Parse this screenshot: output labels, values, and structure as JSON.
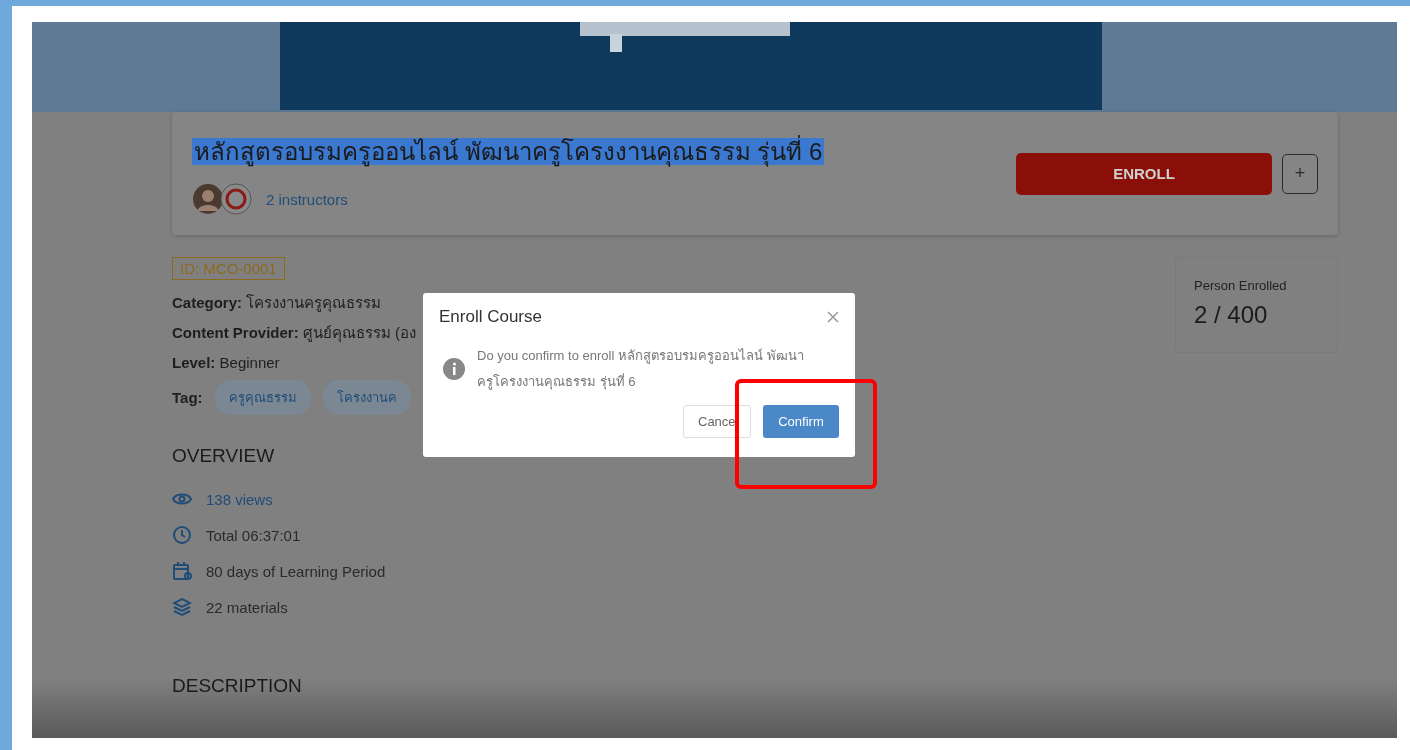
{
  "course": {
    "title": "หลักสูตรอบรมครูออนไลน์ พัฒนาครูโครงงานคุณธรรม รุ่นที่ 6",
    "title_selected": true,
    "instructors": "2 instructors",
    "enroll_button": "ENROLL",
    "add_button": "+"
  },
  "course_id": "ID: MCO-0001",
  "details": [
    {
      "label": "Category:",
      "value": "โครงงานครูคุณธรรม"
    },
    {
      "label": "Content Provider:",
      "value": "ศูนย์คุณธรรม (อง"
    },
    {
      "label": "Level:",
      "value": "Beginner"
    }
  ],
  "tags": {
    "label": "Tag:",
    "items": [
      "ครูคุณธรรม",
      "โครงงานค"
    ]
  },
  "enrollment": {
    "label": "Person Enrolled",
    "value": "2 / 400"
  },
  "overview": {
    "heading": "OVERVIEW",
    "items": [
      {
        "kind": "link",
        "text": "138 views"
      },
      {
        "kind": "text",
        "text": "Total 06:37:01"
      },
      {
        "kind": "text",
        "text": "80 days of Learning Period"
      },
      {
        "kind": "text",
        "text": "22 materials"
      }
    ]
  },
  "description": {
    "heading": "DESCRIPTION"
  },
  "dialog": {
    "title": "Enroll Course",
    "message": "Do you confirm to enroll หลักสูตรอบรมครูออนไลน์ พัฒนาครูโครงงานคุณธรรม รุ่นที่ 6",
    "cancel_button": "Cance",
    "confirm_button": "Confirm"
  }
}
